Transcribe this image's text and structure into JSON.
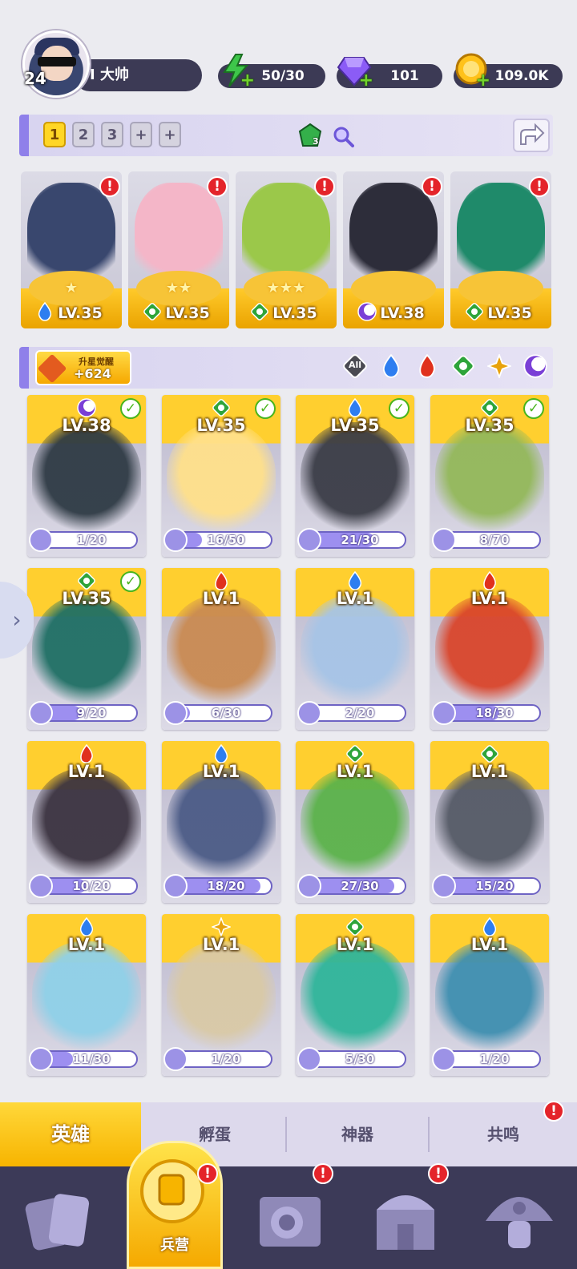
{
  "profile": {
    "level": "24",
    "name": "I 大帅"
  },
  "resources": [
    {
      "icon": "energy-icon",
      "value": "50/30",
      "color": "#4bd14a"
    },
    {
      "icon": "diamond-icon",
      "value": "101",
      "color": "#8b5cf6"
    },
    {
      "icon": "gold-coin-icon",
      "value": "109.0K",
      "color": "#ffc21a"
    }
  ],
  "team": {
    "slots": [
      "1",
      "2",
      "3",
      "+",
      "+"
    ],
    "active_slot": "1",
    "gem_count": "3",
    "members": [
      {
        "level": "LV.35",
        "element": "water",
        "stars": 1,
        "alert": "!",
        "art": "#39476e"
      },
      {
        "level": "LV.35",
        "element": "grass",
        "stars": 2,
        "alert": "!",
        "art": "#f4b6c8"
      },
      {
        "level": "LV.35",
        "element": "grass",
        "stars": 3,
        "alert": "!",
        "art": "#9bc84a"
      },
      {
        "level": "LV.38",
        "element": "dark",
        "stars": 0,
        "alert": "!",
        "art": "#2d2d3a"
      },
      {
        "level": "LV.35",
        "element": "grass",
        "stars": 0,
        "alert": "!",
        "art": "#1f8a6a"
      }
    ]
  },
  "awaken": {
    "title": "升星觉醒",
    "value": "+624"
  },
  "filters": [
    {
      "name": "all",
      "label": "All"
    },
    {
      "name": "water"
    },
    {
      "name": "fire"
    },
    {
      "name": "grass"
    },
    {
      "name": "light"
    },
    {
      "name": "dark"
    }
  ],
  "heroes": [
    {
      "level": "LV.38",
      "element": "dark",
      "owned": true,
      "progress": "1/20",
      "fill": 0.05,
      "art": "#2e3a44"
    },
    {
      "level": "LV.35",
      "element": "grass",
      "owned": true,
      "progress": "16/50",
      "fill": 0.32,
      "art": "#ffe08a"
    },
    {
      "level": "LV.35",
      "element": "water",
      "owned": true,
      "progress": "21/30",
      "fill": 0.7,
      "art": "#3a3c46"
    },
    {
      "level": "LV.35",
      "element": "grass",
      "owned": true,
      "progress": "8/70",
      "fill": 0.11,
      "art": "#93b85a"
    },
    {
      "level": "LV.35",
      "element": "grass",
      "owned": true,
      "progress": "9/20",
      "fill": 0.45,
      "art": "#1f6f64"
    },
    {
      "level": "LV.1",
      "element": "fire",
      "owned": false,
      "progress": "6/30",
      "fill": 0.2,
      "art": "#c98a52"
    },
    {
      "level": "LV.1",
      "element": "water",
      "owned": false,
      "progress": "2/20",
      "fill": 0.1,
      "art": "#a6c4e6"
    },
    {
      "level": "LV.1",
      "element": "fire",
      "owned": false,
      "progress": "18/30",
      "fill": 0.6,
      "art": "#d9452b"
    },
    {
      "level": "LV.1",
      "element": "fire",
      "owned": false,
      "progress": "10/20",
      "fill": 0.5,
      "art": "#3b3340"
    },
    {
      "level": "LV.1",
      "element": "water",
      "owned": false,
      "progress": "18/20",
      "fill": 0.9,
      "art": "#4b5b86"
    },
    {
      "level": "LV.1",
      "element": "grass",
      "owned": false,
      "progress": "27/30",
      "fill": 0.9,
      "art": "#5bb24a"
    },
    {
      "level": "LV.1",
      "element": "grass",
      "owned": false,
      "progress": "15/20",
      "fill": 0.75,
      "art": "#555a66"
    },
    {
      "level": "LV.1",
      "element": "water",
      "owned": false,
      "progress": "11/30",
      "fill": 0.37,
      "art": "#8fd0e8"
    },
    {
      "level": "LV.1",
      "element": "light",
      "owned": false,
      "progress": "1/20",
      "fill": 0.05,
      "art": "#d9c9a6"
    },
    {
      "level": "LV.1",
      "element": "grass",
      "owned": false,
      "progress": "5/30",
      "fill": 0.17,
      "art": "#2fb59a"
    },
    {
      "level": "LV.1",
      "element": "water",
      "owned": false,
      "progress": "1/20",
      "fill": 0.05,
      "art": "#3f8fb0"
    }
  ],
  "tabs": [
    {
      "label": "英雄",
      "active": true
    },
    {
      "label": "孵蛋"
    },
    {
      "label": "神器"
    },
    {
      "label": "共鸣",
      "alert": "!"
    }
  ],
  "nav": [
    {
      "name": "cards-icon",
      "alert": null
    },
    {
      "name": "barracks-icon",
      "label": "兵营",
      "active": true,
      "alert": "!"
    },
    {
      "name": "map-icon",
      "alert": "!"
    },
    {
      "name": "castle-icon",
      "alert": "!"
    },
    {
      "name": "mushroom-icon",
      "alert": null
    }
  ],
  "side_arrow": "›",
  "element_colors": {
    "water": "#2e7ef0",
    "fire": "#e0311d",
    "grass": "#2ea43a",
    "light": "#e8a20a",
    "dark": "#7a3fd6"
  }
}
